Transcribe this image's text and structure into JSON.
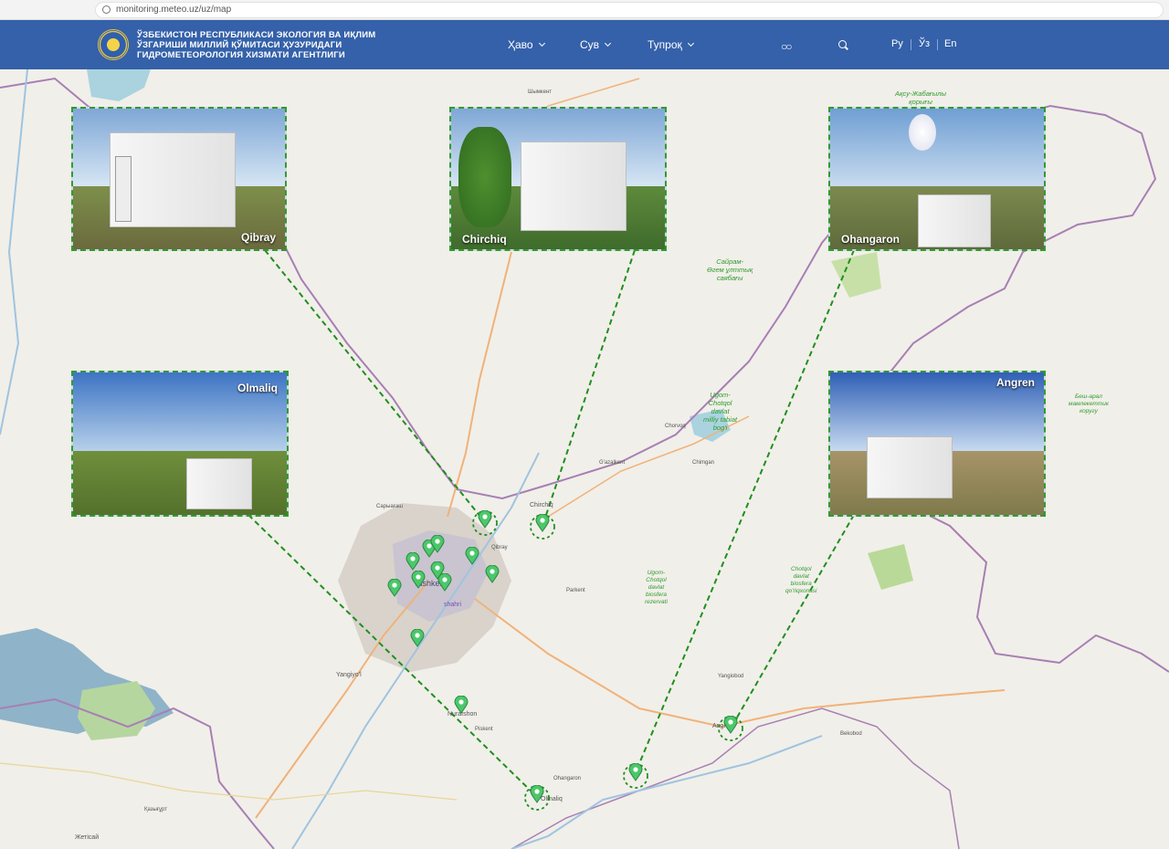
{
  "browser": {
    "url": "monitoring.meteo.uz/uz/map"
  },
  "header": {
    "agency_line1": "ЎЗБЕКИСТОН РЕСПУБЛИКАСИ ЭКОЛОГИЯ ВА ИҚЛИМ",
    "agency_line2": "ЎЗГАРИШИ МИЛЛИЙ ҚЎМИТАСИ ҲУЗУРИДАГИ",
    "agency_line3": "ГИДРОМЕТЕОРОЛОГИЯ ХИЗМАТИ АГЕНТЛИГИ",
    "nav": {
      "havo": "Ҳаво",
      "suv": "Сув",
      "tuproq": "Тупроқ"
    },
    "accessibility_glyph": "○○",
    "languages": {
      "ru": "Ру",
      "uz": "Ўз",
      "en": "En"
    }
  },
  "map": {
    "places": {
      "shymkent": "Шымкент",
      "sarymash": "Сарыағаш",
      "tashkent": "Tashkent",
      "tashkent_shahri": "shahri",
      "chirchiq_town": "Chirchiq",
      "yangiyol": "Yangiyo'l",
      "nurafshon": "Nurafshon",
      "olmaliq_town": "Olmaliq",
      "angren_town": "Angren",
      "zhetisay": "Жетісай",
      "kazygurt": "Қазығұрт",
      "qibray_town": "Qibray",
      "parkent": "Parkent",
      "chorvoq": "Chorvoq",
      "chimgan": "Chimgan",
      "gazalkent": "G'azalkent",
      "ohangaron_town": "Ohangaron",
      "yangiobod": "Yangiobod",
      "piskent": "Piskent",
      "bekobod": "Bekobod"
    },
    "parks": {
      "aksu": "Ақсу-Жабағылы\nқорығы",
      "sayram": "Сайрам-\nӨгем ұлттық\nсаябағы",
      "ugom": "Ugom-\nChotqol\ndavlat\nmilliy tabiat\nbog'i",
      "ugom_biosphere": "Ugom-\nChotqol\ndavlat\nbiosfera\nrezervati",
      "chotqol": "Chotqol\ndavlat\nbiosfera\nqo'riqxonasi",
      "besh_aral": "Беш-арал\nмамлекеттик\nкоругу"
    },
    "stations": {
      "qibray": "Qibray",
      "chirchiq": "Chirchiq",
      "ohangaron": "Ohangaron",
      "olmaliq": "Olmaliq",
      "angren": "Angren"
    }
  },
  "colors": {
    "header": "#3461a9",
    "accent": "#2f9b2f",
    "pin": "#4cc76a"
  }
}
